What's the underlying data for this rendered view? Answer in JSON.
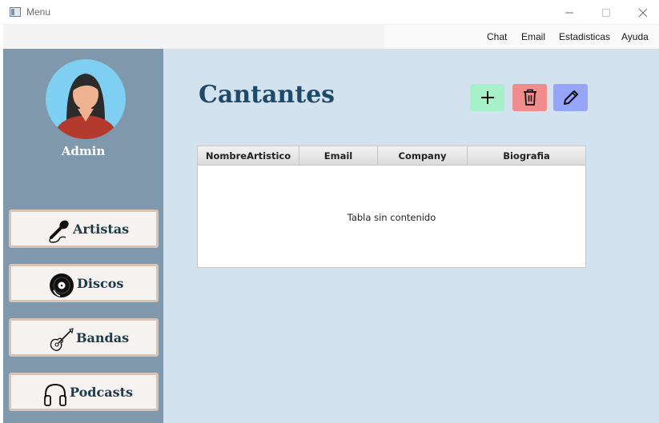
{
  "window": {
    "title": "Menu"
  },
  "menubar": {
    "items": [
      "Chat",
      "Email",
      "Estadisticas",
      "Ayuda"
    ]
  },
  "sidebar": {
    "user_name": "Admin",
    "nav": [
      {
        "label": "Artistas",
        "icon": "microphone-icon"
      },
      {
        "label": "Discos",
        "icon": "vinyl-disc-icon"
      },
      {
        "label": "Bandas",
        "icon": "guitar-icon"
      },
      {
        "label": "Podcasts",
        "icon": "headphones-icon"
      }
    ]
  },
  "main": {
    "title": "Cantantes",
    "actions": [
      {
        "name": "add",
        "icon": "plus-icon",
        "color": "#a6f1c9"
      },
      {
        "name": "delete",
        "icon": "trash-icon",
        "color": "#f08c8c"
      },
      {
        "name": "edit",
        "icon": "pencil-icon",
        "color": "#96a5fa"
      }
    ],
    "table": {
      "columns": [
        "NombreArtistico",
        "Email",
        "Company",
        "Biografia"
      ],
      "rows": [],
      "empty_message": "Tabla sin contenido"
    }
  },
  "colors": {
    "sidebar_bg": "#7f98ac",
    "main_bg": "#d3e2ef",
    "title_color": "#1e4a6a",
    "nav_button_bg": "#f5f2ef",
    "nav_button_border": "#d9c3b4"
  }
}
